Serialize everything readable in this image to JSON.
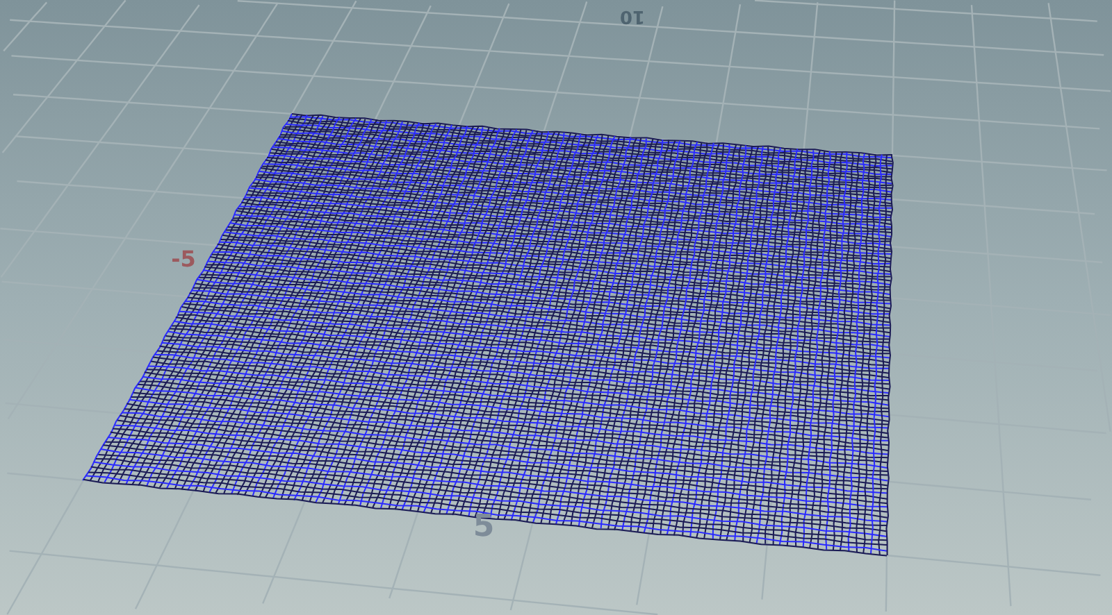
{
  "viewport": {
    "axis_labels": [
      {
        "text": "10",
        "kind": "far"
      },
      {
        "text": "-5",
        "kind": "negative"
      },
      {
        "text": "5",
        "kind": "positive"
      }
    ]
  }
}
